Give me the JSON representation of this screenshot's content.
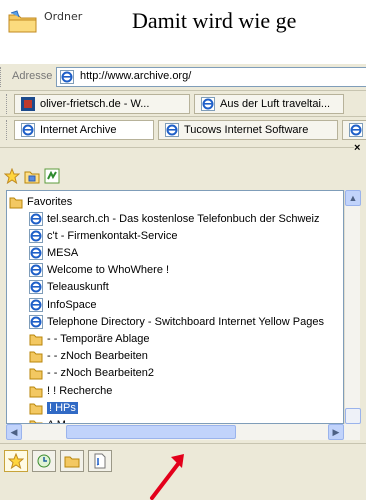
{
  "header": {
    "ordner_label": "Ordner",
    "headline": "Damit wird wie ge"
  },
  "address_bar": {
    "label": "Adresse",
    "url": "http://www.archive.org/"
  },
  "tabs_row1": [
    {
      "label": "oliver-frietsch.de - W..."
    },
    {
      "label": "Aus der Luft traveltai..."
    }
  ],
  "tabs_row2": [
    {
      "label": "Internet Archive"
    },
    {
      "label": "Tucows Internet Software"
    }
  ],
  "favorites": {
    "close_glyph": "×",
    "root": "Favorites",
    "items": [
      {
        "label": "tel.search.ch - Das kostenlose Telefonbuch der Schweiz",
        "type": "link"
      },
      {
        "label": "c't - Firmenkontakt-Service",
        "type": "link"
      },
      {
        "label": "MESA",
        "type": "link"
      },
      {
        "label": "Welcome to WhoWhere !",
        "type": "link"
      },
      {
        "label": "Teleauskunft",
        "type": "link"
      },
      {
        "label": "InfoSpace",
        "type": "link"
      },
      {
        "label": "Telephone Directory - Switchboard Internet Yellow Pages",
        "type": "link"
      },
      {
        "label": "-        - Temporäre Ablage",
        "type": "folder"
      },
      {
        "label": "-        - zNoch Bearbeiten",
        "type": "folder"
      },
      {
        "label": "-        - zNoch Bearbeiten2",
        "type": "folder"
      },
      {
        "label": "! ! Recherche",
        "type": "folder"
      },
      {
        "label": "! HPs",
        "type": "folder",
        "selected": true
      },
      {
        "label": "A M",
        "type": "folder"
      }
    ]
  },
  "colors": {
    "selection": "#316ac5",
    "frame": "#ece9d8",
    "arrow": "#e3001b"
  }
}
